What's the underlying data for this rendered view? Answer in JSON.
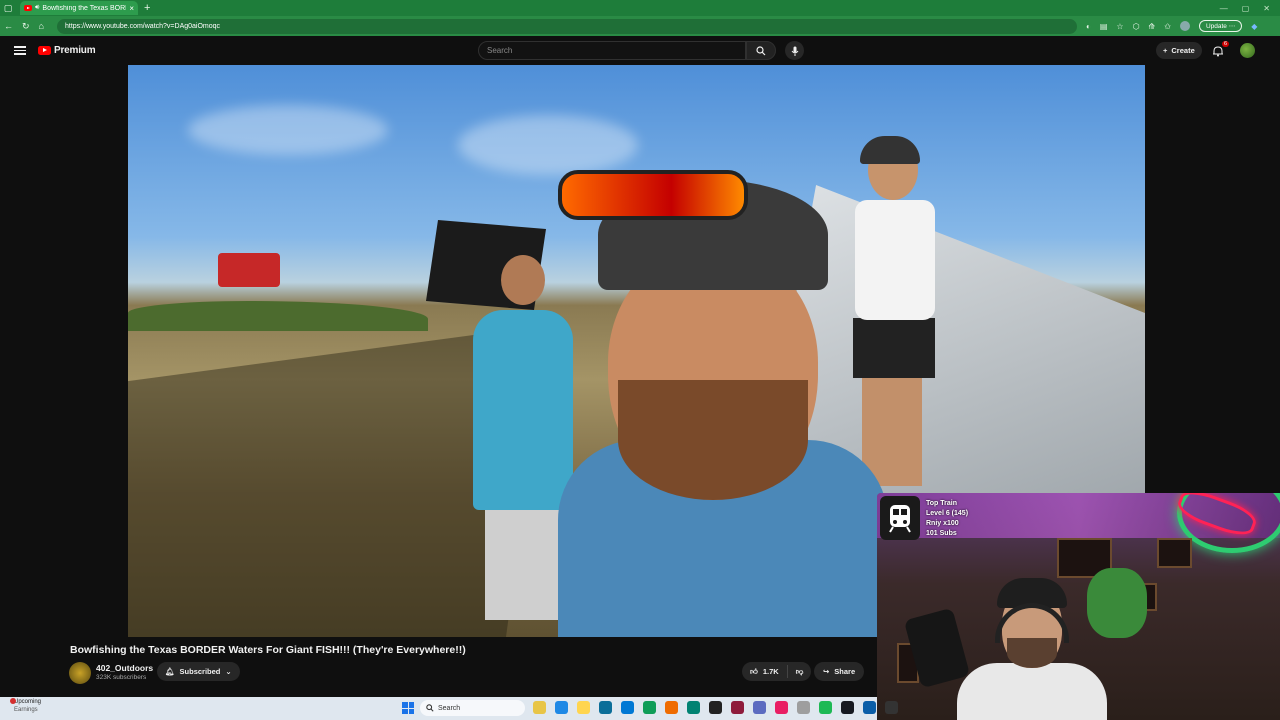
{
  "browser": {
    "tab_title": "Bowfishing the Texas BORDER",
    "tab_close": "×",
    "new_tab": "+",
    "url": "https://www.youtube.com/watch?v=DAg0aiOmoqc",
    "update_label": "Update",
    "update_more": "⋯"
  },
  "youtube": {
    "logo_text": "Premium",
    "search_placeholder": "Search",
    "create_label": "Create",
    "notification_count": "6"
  },
  "video": {
    "title": "Bowfishing the Texas BORDER Waters For Giant FISH!!! (They're Everywhere!!)",
    "channel_name": "402_Outdoors",
    "subscriber_count": "323K subscribers",
    "subscribed_label": "Subscribed",
    "like_count": "1.7K",
    "share_label": "Share"
  },
  "stream_overlay": {
    "train_label": "Top Train",
    "level": "Level 6  (145)",
    "rniy": "Rniy x100",
    "subs": "101 Subs"
  },
  "taskbar": {
    "weather_title": "Upcoming",
    "weather_sub": "Earnings",
    "search_label": "Search",
    "app_colors": [
      "#e8c547",
      "#1e88e5",
      "#ffd54f",
      "#0b6e99",
      "#0078d4",
      "#0f9d58",
      "#ef6c00",
      "#008272",
      "#222222",
      "#8e1b3b",
      "#5c6bc0",
      "#e91e63",
      "#9e9e9e",
      "#1db954",
      "#171a21",
      "#0a5ea8",
      "#333333"
    ]
  },
  "colors": {
    "browser_green": "#1e7d3a",
    "youtube_red": "#ff0000",
    "page_bg": "#0f0f0f"
  }
}
